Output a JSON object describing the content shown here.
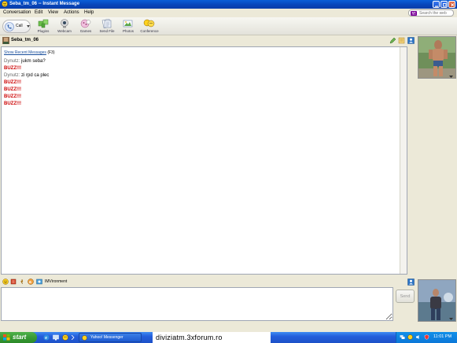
{
  "window": {
    "title": "Seba_tm_06 -- Instant Message"
  },
  "menu": {
    "items": [
      "Conversation",
      "Edit",
      "View",
      "Actions",
      "Help"
    ],
    "search_placeholder": "Search the web"
  },
  "toolbar": {
    "call_label": "Call",
    "tools": [
      {
        "label": "Plugins",
        "icon": "plugins-icon"
      },
      {
        "label": "Webcam",
        "icon": "webcam-icon"
      },
      {
        "label": "Games",
        "icon": "games-icon"
      },
      {
        "label": "Send File",
        "icon": "send-file-icon"
      },
      {
        "label": "Photos",
        "icon": "photos-icon"
      },
      {
        "label": "Conference",
        "icon": "conference-icon"
      }
    ]
  },
  "contact": {
    "name": "Seba_tm_06"
  },
  "chat": {
    "show_recent_link": "Show Recent Messages",
    "show_recent_shortcut": "(F3)",
    "messages": [
      {
        "sender": "Dynutz:",
        "text": "jukm seba?"
      },
      {
        "sender": "Dynutz:",
        "text": "zi rpd ca plec"
      }
    ],
    "buzzes": [
      "BUZZ!!!",
      "BUZZ!!!",
      "BUZZ!!!",
      "BUZZ!!!",
      "BUZZ!!!"
    ]
  },
  "formatbar": {
    "imvironment_label": "IMVironment"
  },
  "input": {
    "send_label": "Send"
  },
  "taskbar": {
    "start_label": "start",
    "task_label": "Yahoo! Messenger",
    "overlay_text": "diviziatm.3xforum.ro",
    "clock": "11:01 PM"
  },
  "colors": {
    "buzz": "#cc0000",
    "link": "#1a4f9c",
    "titlebar": "#0a5fd8",
    "taskbar": "#245edb",
    "start": "#3a9a35"
  }
}
